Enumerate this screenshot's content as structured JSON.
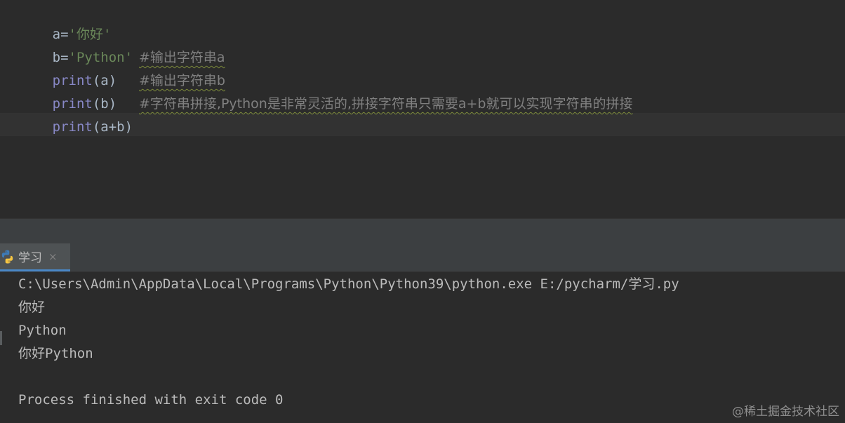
{
  "editor": {
    "lines": [
      {
        "var": "a",
        "op": "=",
        "value": "'你好'"
      },
      {
        "var": "b",
        "op": "=",
        "value": "'Python'"
      },
      {
        "fn": "print",
        "open": "(",
        "arg": "a",
        "close": ")",
        "comment": "#输出字符串a"
      },
      {
        "fn": "print",
        "open": "(",
        "arg": "b",
        "close": ")",
        "comment": "#输出字符串b"
      },
      {
        "fn": "print",
        "open": "(",
        "arg": "a+b",
        "close": ")",
        "comment": "#字符串拼接,Python是非常灵活的,拼接字符串只需要a+b就可以实现字符串的拼接"
      }
    ]
  },
  "run_panel": {
    "tab_label": "学习",
    "close_glyph": "×",
    "icon": "python-icon",
    "output": [
      "C:\\Users\\Admin\\AppData\\Local\\Programs\\Python\\Python39\\python.exe E:/pycharm/学习.py",
      "你好",
      "Python",
      "你好Python",
      "",
      "Process finished with exit code 0"
    ]
  },
  "watermark": "@稀土掘金技术社区",
  "colors": {
    "background": "#2b2b2b",
    "string": "#6a8759",
    "builtin": "#8888c6",
    "comment": "#808080",
    "text": "#a9b7c6",
    "tab_accent": "#4a88c7"
  }
}
